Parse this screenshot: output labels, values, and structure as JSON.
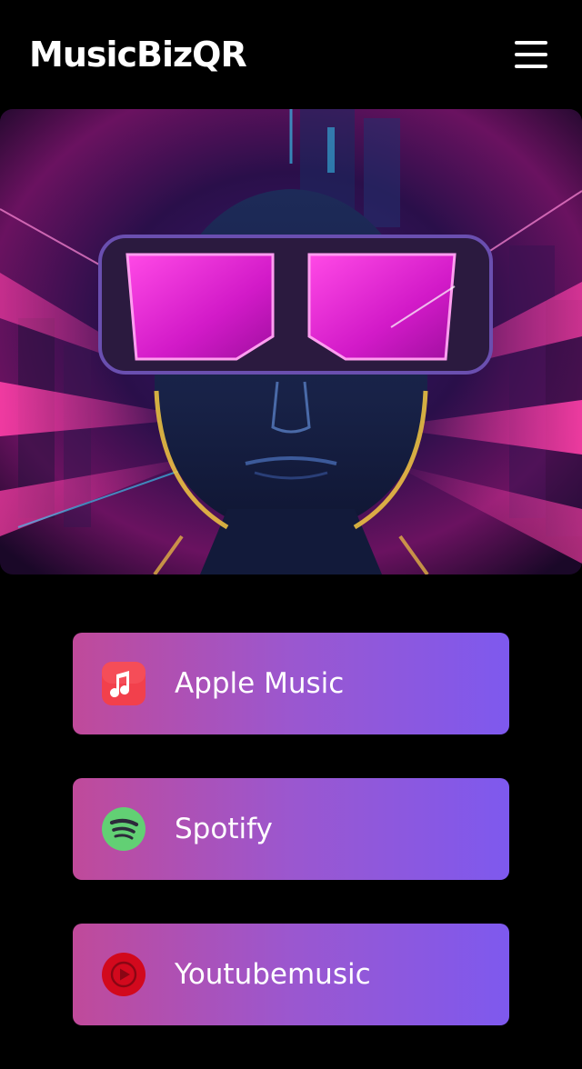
{
  "header": {
    "brand": "MusicBizQR",
    "menu_icon": "hamburger-menu-icon"
  },
  "hero": {
    "image_subject": "neon cyberpunk portrait with pink visor glasses",
    "colors": {
      "magenta": "#e21fc7",
      "pink": "#ff3fa8",
      "cyan": "#38d6ff",
      "gold": "#f5c842",
      "deep_navy": "#141a3a"
    }
  },
  "links": [
    {
      "label": "Apple Music",
      "icon": "apple-music-icon",
      "icon_color": "#f2404c"
    },
    {
      "label": "Spotify",
      "icon": "spotify-icon",
      "icon_color": "#62d074"
    },
    {
      "label": "Youtubemusic",
      "icon": "youtube-music-icon",
      "icon_color": "#d2091d"
    }
  ],
  "theme": {
    "background": "#000000",
    "button_gradient": [
      "#c04a9a",
      "#7e59ee"
    ],
    "text": "#ffffff"
  }
}
